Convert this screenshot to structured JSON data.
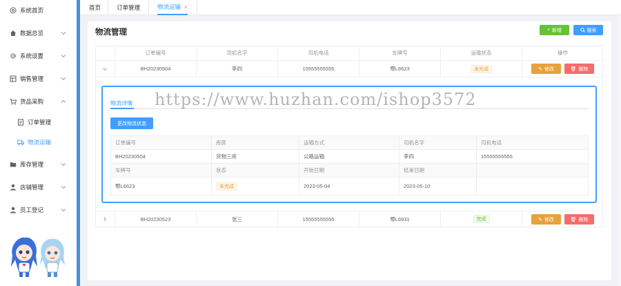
{
  "sidebar": {
    "items": [
      {
        "label": "系统首页",
        "icon": "home-circle-icon",
        "arrow": false
      },
      {
        "label": "数据总览",
        "icon": "house-icon",
        "arrow": true
      },
      {
        "label": "系统设置",
        "icon": "gear-icon",
        "arrow": true
      },
      {
        "label": "销售管理",
        "icon": "grid-icon",
        "arrow": true
      },
      {
        "label": "货品采购",
        "icon": "cart-icon",
        "arrow": true,
        "expanded": true
      },
      {
        "label": "订单管理",
        "icon": "document-icon",
        "sub": true
      },
      {
        "label": "物流运输",
        "icon": "truck-icon",
        "sub": true,
        "active": true
      },
      {
        "label": "库存管理",
        "icon": "folder-icon",
        "arrow": true
      },
      {
        "label": "店铺管理",
        "icon": "person-icon",
        "arrow": true
      },
      {
        "label": "员工登记",
        "icon": "person-icon",
        "arrow": true
      }
    ]
  },
  "tabs": [
    {
      "label": "首页"
    },
    {
      "label": "订单管理"
    },
    {
      "label": "物流运输",
      "active": true,
      "close": "×"
    }
  ],
  "page": {
    "title": "物流管理",
    "add_label": "新增",
    "search_label": "搜索"
  },
  "table": {
    "headers": [
      "订单编号",
      "司机名字",
      "司机电话",
      "车牌号",
      "运输状态",
      "操作"
    ],
    "rows": [
      {
        "order": "BH20230504",
        "driver": "李四",
        "phone": "15555555555",
        "plate": "鄂L6623",
        "status": "未完成",
        "status_type": "warn"
      },
      {
        "order": "BH20230523",
        "driver": "张三",
        "phone": "15555555555",
        "plate": "鄂L6931",
        "status": "完成",
        "status_type": "ok"
      }
    ],
    "edit_label": "修改",
    "delete_label": "删除"
  },
  "detail": {
    "tab_label": "物流详情",
    "change_status_label": "更改物流状态",
    "labels1": [
      "订单编号",
      "库房",
      "运输方式",
      "司机名字",
      "司机电话"
    ],
    "values1": [
      "BH20230504",
      "货物三库",
      "公路运输",
      "李四",
      "15555555555"
    ],
    "labels2": [
      "车牌号",
      "状态",
      "开始日期",
      "结束日期",
      ""
    ],
    "values2": [
      "鄂L6623",
      "未完成",
      "2023-05-04",
      "2023-05-10",
      ""
    ]
  },
  "watermark": "https://www.huzhan.com/ishop3572",
  "colors": {
    "primary": "#409eff",
    "success": "#67c23a",
    "warning": "#e6a23c",
    "danger": "#f56c6c"
  }
}
